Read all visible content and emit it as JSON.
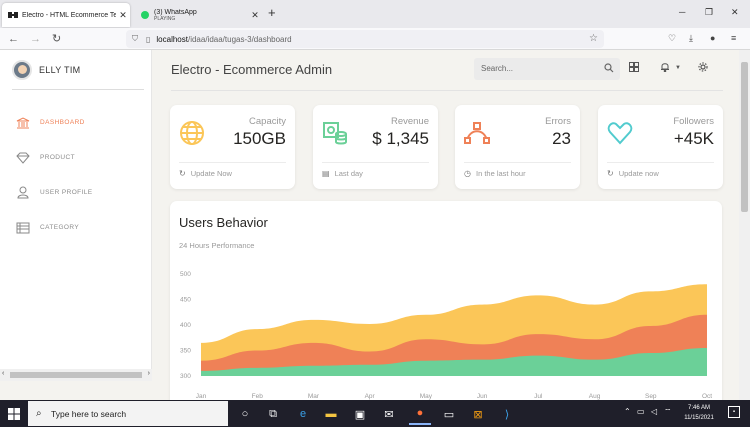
{
  "browser": {
    "tabs": [
      {
        "title": "Electro - HTML Ecommerce Temp",
        "subtitle": ""
      },
      {
        "title": "(3) WhatsApp",
        "subtitle": "PLAYING"
      }
    ],
    "url_host": "localhost",
    "url_path": "/idaa/idaa/tugas-3/dashboard"
  },
  "sidebar": {
    "user_name": "ELLY TIM",
    "items": [
      {
        "label": "DASHBOARD",
        "icon": "bank-icon",
        "active": true
      },
      {
        "label": "PRODUCT",
        "icon": "diamond-icon",
        "active": false
      },
      {
        "label": "USER PROFILE",
        "icon": "user-icon",
        "active": false
      },
      {
        "label": "CATEGORY",
        "icon": "list-icon",
        "active": false
      }
    ]
  },
  "header": {
    "title": "Electro - Ecommerce Admin",
    "search_placeholder": "Search..."
  },
  "cards": [
    {
      "label": "Capacity",
      "value": "150GB",
      "footer": "Update Now",
      "icon": "globe-icon",
      "color": "#fbc658",
      "footer_icon": "refresh-icon"
    },
    {
      "label": "Revenue",
      "value": "$ 1,345",
      "footer": "Last day",
      "icon": "money-icon",
      "color": "#6bd098",
      "footer_icon": "calendar-icon"
    },
    {
      "label": "Errors",
      "value": "23",
      "footer": "In the last hour",
      "icon": "vector-icon",
      "color": "#ef8157",
      "footer_icon": "clock-icon"
    },
    {
      "label": "Followers",
      "value": "+45K",
      "footer": "Update now",
      "icon": "heart-icon",
      "color": "#51cbce",
      "footer_icon": "refresh-icon"
    }
  ],
  "chart": {
    "title": "Users Behavior",
    "subtitle": "24 Hours Performance"
  },
  "chart_data": {
    "type": "area",
    "categories": [
      "Jan",
      "Feb",
      "Mar",
      "Apr",
      "May",
      "Jun",
      "Jul",
      "Aug",
      "Sep",
      "Oct"
    ],
    "ylim": [
      300,
      500
    ],
    "yticks": [
      300,
      350,
      400,
      450,
      500
    ],
    "grid": false,
    "series": [
      {
        "color": "#6bd098",
        "values": [
          310,
          316,
          320,
          322,
          330,
          332,
          340,
          332,
          345,
          355
        ]
      },
      {
        "color": "#ef8157",
        "values": [
          330,
          350,
          365,
          348,
          372,
          362,
          382,
          372,
          398,
          420
        ]
      },
      {
        "color": "#fbc658",
        "values": [
          365,
          392,
          410,
          402,
          420,
          440,
          458,
          440,
          466,
          480
        ]
      }
    ]
  },
  "taskbar": {
    "search_placeholder": "Type here to search",
    "time": "7:46 AM",
    "date": "11/15/2021"
  }
}
